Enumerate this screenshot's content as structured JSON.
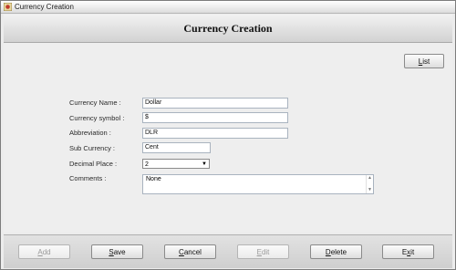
{
  "window": {
    "title": "Currency Creation"
  },
  "header": {
    "title": "Currency Creation"
  },
  "list_button": {
    "mnemonic": "L",
    "rest": "ist"
  },
  "form": {
    "currency_name": {
      "label": "Currency Name :",
      "value": "Dollar"
    },
    "currency_symbol": {
      "label": "Currency symbol :",
      "value": "$"
    },
    "abbreviation": {
      "label": "Abbreviation :",
      "value": "DLR"
    },
    "sub_currency": {
      "label": "Sub Currency :",
      "value": "Cent"
    },
    "decimal_place": {
      "label": "Decimal Place :",
      "value": "2"
    },
    "comments": {
      "label": "Comments :",
      "value": "None"
    }
  },
  "footer": {
    "add": {
      "mnemonic": "A",
      "rest": "dd",
      "enabled": false
    },
    "save": {
      "mnemonic": "S",
      "rest": "ave",
      "enabled": true
    },
    "cancel": {
      "mnemonic": "C",
      "rest": "ancel",
      "enabled": true
    },
    "edit": {
      "mnemonic": "E",
      "rest": "dit",
      "enabled": false
    },
    "delete": {
      "mnemonic": "D",
      "rest": "elete",
      "enabled": true
    },
    "exit": {
      "mnemonic": "x",
      "prefix": "E",
      "rest": "it",
      "enabled": true
    }
  }
}
